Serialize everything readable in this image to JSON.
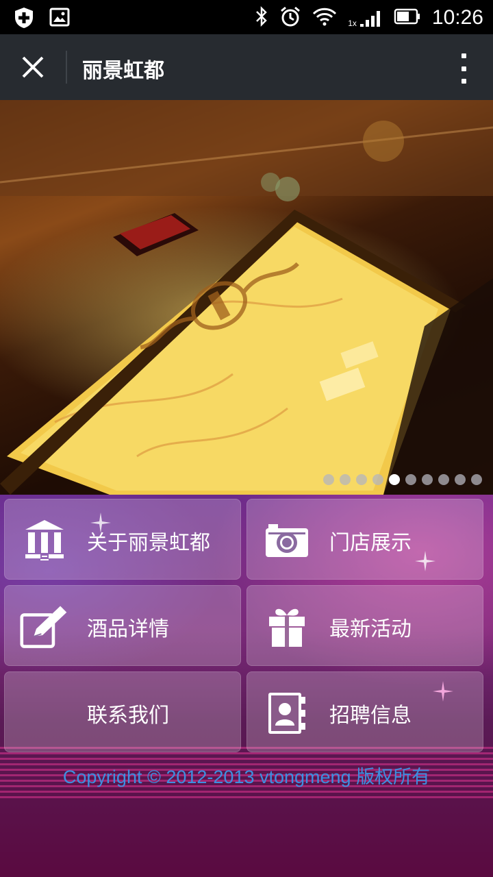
{
  "status_bar": {
    "time": "10:26",
    "network_label": "1x",
    "icons": [
      "shield-plus-icon",
      "image-icon",
      "bluetooth-icon",
      "alarm-icon",
      "wifi-icon",
      "signal-icon",
      "battery-icon"
    ]
  },
  "title_bar": {
    "title": "丽景虹都",
    "close_icon": "close-icon",
    "more_icon": "more-vertical-icon"
  },
  "banner": {
    "slide_count": 10,
    "active_slide": 5
  },
  "menu": {
    "items": [
      {
        "label": "关于丽景虹都",
        "icon": "institution-icon"
      },
      {
        "label": "门店展示",
        "icon": "camera-icon"
      },
      {
        "label": "酒品详情",
        "icon": "edit-icon"
      },
      {
        "label": "最新活动",
        "icon": "gift-icon"
      },
      {
        "label": "联系我们",
        "icon": ""
      },
      {
        "label": "招聘信息",
        "icon": "contact-book-icon"
      }
    ]
  },
  "footer": {
    "copyright": "Copyright © 2012-2013 vtongmeng 版权所有"
  },
  "colors": {
    "status_bar": "#000000",
    "title_bar": "#272b30",
    "footer_text": "#3d8fe0",
    "menu_bottom": "#5a0a40"
  }
}
